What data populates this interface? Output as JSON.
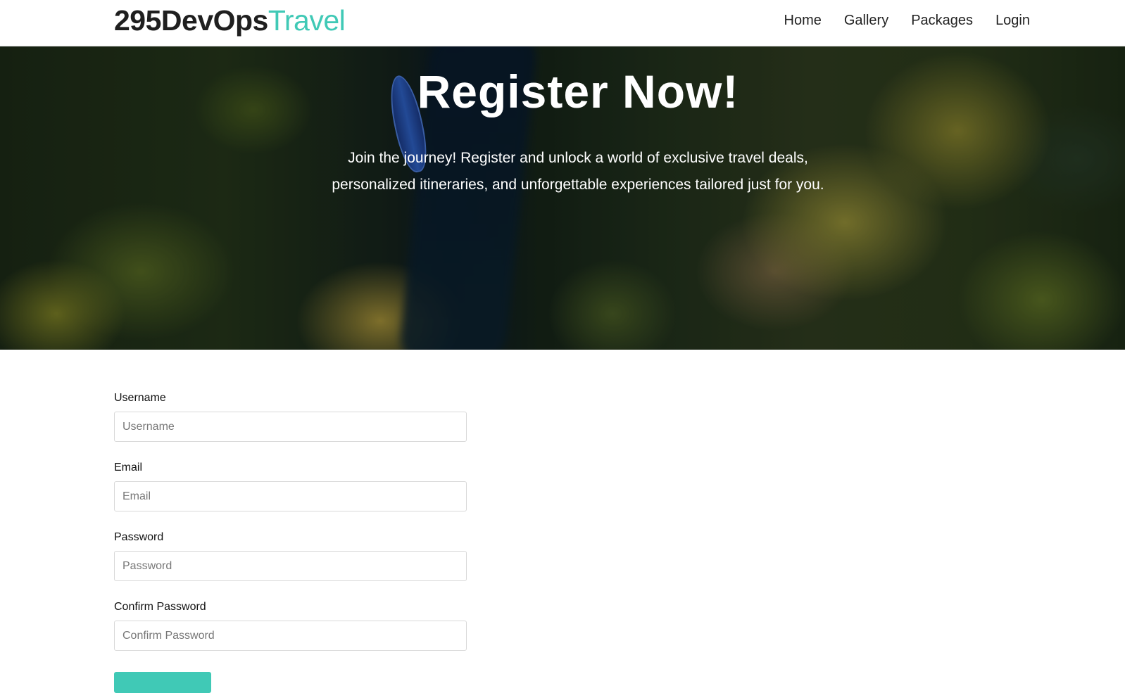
{
  "brand": {
    "part1": "295DevOps",
    "part2": "Travel",
    "accent_color": "#40c9b6"
  },
  "nav": {
    "items": [
      {
        "label": "Home"
      },
      {
        "label": "Gallery"
      },
      {
        "label": "Packages"
      },
      {
        "label": "Login"
      }
    ]
  },
  "hero": {
    "title": "Register Now!",
    "text": "Join the journey! Register and unlock a world of exclusive travel deals, personalized itineraries, and unforgettable experiences tailored just for you.",
    "image": "aerial-forest-river-photo"
  },
  "form": {
    "fields": [
      {
        "label": "Username",
        "placeholder": "Username"
      },
      {
        "label": "Email",
        "placeholder": "Email"
      },
      {
        "label": "Password",
        "placeholder": "Password"
      },
      {
        "label": "Confirm Password",
        "placeholder": "Confirm Password"
      }
    ],
    "submit_color": "#40c9b6"
  }
}
